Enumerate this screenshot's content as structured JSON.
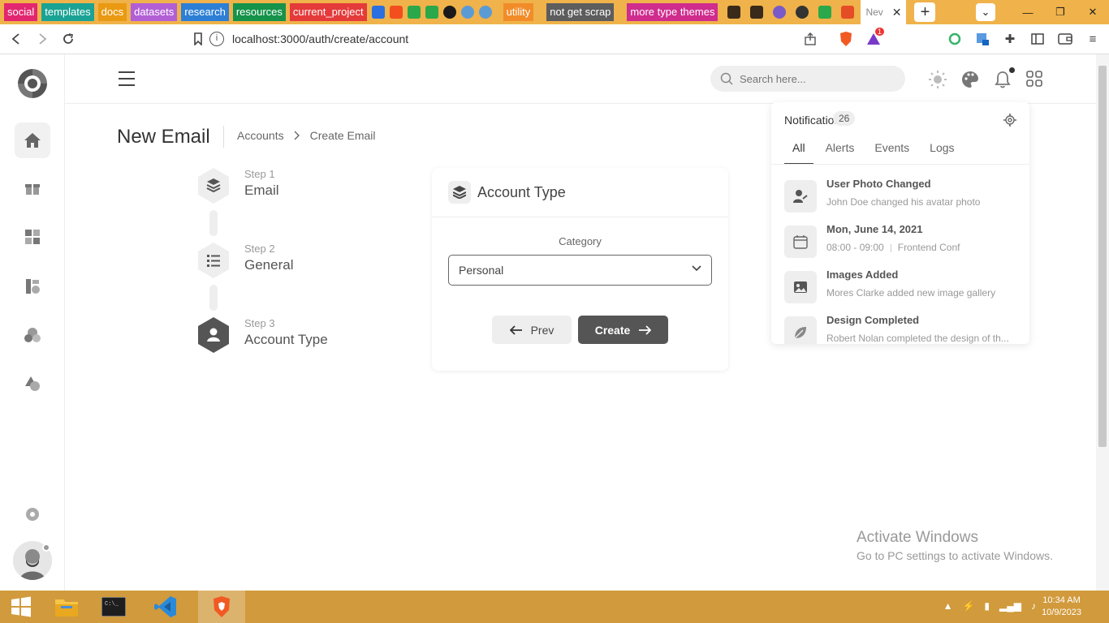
{
  "browser": {
    "bookmarks": [
      {
        "label": "social",
        "color": "#e2266f"
      },
      {
        "label": "templates",
        "color": "#1aa394"
      },
      {
        "label": "docs",
        "color": "#e99a12"
      },
      {
        "label": "datasets",
        "color": "#b25fd6"
      },
      {
        "label": "research",
        "color": "#2d7fd6"
      },
      {
        "label": "resources",
        "color": "#15934a"
      },
      {
        "label": "current_project",
        "color": "#e53a3a"
      }
    ],
    "bookmarks2": [
      {
        "label": "utility",
        "color": "#f28c28"
      },
      {
        "label": "not get scrap",
        "color": "#5d5d5d"
      },
      {
        "label": "more type themes",
        "color": "#cf2c8e"
      }
    ],
    "current_tab": "Nev",
    "url": "localhost:3000/auth/create/account",
    "brave_badge": "1"
  },
  "header": {
    "search_placeholder": "Search here..."
  },
  "page": {
    "title": "New Email",
    "breadcrumb": [
      "Accounts",
      "Create Email"
    ]
  },
  "steps": [
    {
      "label": "Step 1",
      "name": "Email"
    },
    {
      "label": "Step 2",
      "name": "General"
    },
    {
      "label": "Step 3",
      "name": "Account Type"
    }
  ],
  "card": {
    "title": "Account Type",
    "category_label": "Category",
    "category_value": "Personal",
    "prev_label": "Prev",
    "create_label": "Create"
  },
  "notifications": {
    "title": "Notifications",
    "count": "26",
    "tabs": [
      "All",
      "Alerts",
      "Events",
      "Logs"
    ],
    "items": [
      {
        "title": "User Photo Changed",
        "sub": "John Doe changed his avatar photo"
      },
      {
        "title": "Mon, June 14, 2021",
        "sub_a": "08:00 - 09:00",
        "sub_b": "Frontend Conf"
      },
      {
        "title": "Images Added",
        "sub": "Mores Clarke added new image gallery"
      },
      {
        "title": "Design Completed",
        "sub": "Robert Nolan completed the design of th..."
      }
    ]
  },
  "watermark": {
    "line1": "Activate Windows",
    "line2": "Go to PC settings to activate Windows."
  },
  "taskbar": {
    "time": "10:34 AM",
    "date": "10/9/2023"
  }
}
